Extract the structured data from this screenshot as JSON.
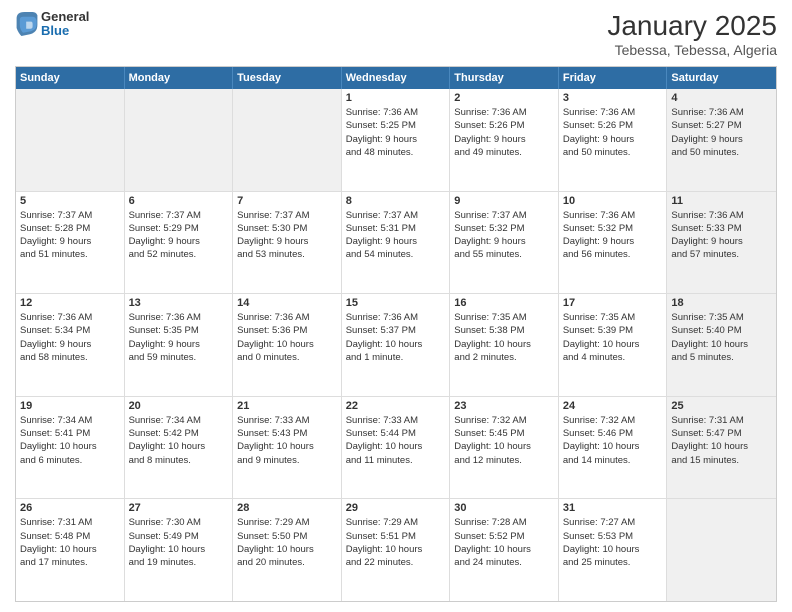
{
  "logo": {
    "general": "General",
    "blue": "Blue"
  },
  "title": "January 2025",
  "subtitle": "Tebessa, Tebessa, Algeria",
  "header_days": [
    "Sunday",
    "Monday",
    "Tuesday",
    "Wednesday",
    "Thursday",
    "Friday",
    "Saturday"
  ],
  "weeks": [
    [
      {
        "day": "",
        "text": "",
        "shaded": true
      },
      {
        "day": "",
        "text": "",
        "shaded": true
      },
      {
        "day": "",
        "text": "",
        "shaded": true
      },
      {
        "day": "1",
        "text": "Sunrise: 7:36 AM\nSunset: 5:25 PM\nDaylight: 9 hours\nand 48 minutes."
      },
      {
        "day": "2",
        "text": "Sunrise: 7:36 AM\nSunset: 5:26 PM\nDaylight: 9 hours\nand 49 minutes."
      },
      {
        "day": "3",
        "text": "Sunrise: 7:36 AM\nSunset: 5:26 PM\nDaylight: 9 hours\nand 50 minutes."
      },
      {
        "day": "4",
        "text": "Sunrise: 7:36 AM\nSunset: 5:27 PM\nDaylight: 9 hours\nand 50 minutes.",
        "shaded": true
      }
    ],
    [
      {
        "day": "5",
        "text": "Sunrise: 7:37 AM\nSunset: 5:28 PM\nDaylight: 9 hours\nand 51 minutes."
      },
      {
        "day": "6",
        "text": "Sunrise: 7:37 AM\nSunset: 5:29 PM\nDaylight: 9 hours\nand 52 minutes."
      },
      {
        "day": "7",
        "text": "Sunrise: 7:37 AM\nSunset: 5:30 PM\nDaylight: 9 hours\nand 53 minutes."
      },
      {
        "day": "8",
        "text": "Sunrise: 7:37 AM\nSunset: 5:31 PM\nDaylight: 9 hours\nand 54 minutes."
      },
      {
        "day": "9",
        "text": "Sunrise: 7:37 AM\nSunset: 5:32 PM\nDaylight: 9 hours\nand 55 minutes."
      },
      {
        "day": "10",
        "text": "Sunrise: 7:36 AM\nSunset: 5:32 PM\nDaylight: 9 hours\nand 56 minutes."
      },
      {
        "day": "11",
        "text": "Sunrise: 7:36 AM\nSunset: 5:33 PM\nDaylight: 9 hours\nand 57 minutes.",
        "shaded": true
      }
    ],
    [
      {
        "day": "12",
        "text": "Sunrise: 7:36 AM\nSunset: 5:34 PM\nDaylight: 9 hours\nand 58 minutes."
      },
      {
        "day": "13",
        "text": "Sunrise: 7:36 AM\nSunset: 5:35 PM\nDaylight: 9 hours\nand 59 minutes."
      },
      {
        "day": "14",
        "text": "Sunrise: 7:36 AM\nSunset: 5:36 PM\nDaylight: 10 hours\nand 0 minutes."
      },
      {
        "day": "15",
        "text": "Sunrise: 7:36 AM\nSunset: 5:37 PM\nDaylight: 10 hours\nand 1 minute."
      },
      {
        "day": "16",
        "text": "Sunrise: 7:35 AM\nSunset: 5:38 PM\nDaylight: 10 hours\nand 2 minutes."
      },
      {
        "day": "17",
        "text": "Sunrise: 7:35 AM\nSunset: 5:39 PM\nDaylight: 10 hours\nand 4 minutes."
      },
      {
        "day": "18",
        "text": "Sunrise: 7:35 AM\nSunset: 5:40 PM\nDaylight: 10 hours\nand 5 minutes.",
        "shaded": true
      }
    ],
    [
      {
        "day": "19",
        "text": "Sunrise: 7:34 AM\nSunset: 5:41 PM\nDaylight: 10 hours\nand 6 minutes."
      },
      {
        "day": "20",
        "text": "Sunrise: 7:34 AM\nSunset: 5:42 PM\nDaylight: 10 hours\nand 8 minutes."
      },
      {
        "day": "21",
        "text": "Sunrise: 7:33 AM\nSunset: 5:43 PM\nDaylight: 10 hours\nand 9 minutes."
      },
      {
        "day": "22",
        "text": "Sunrise: 7:33 AM\nSunset: 5:44 PM\nDaylight: 10 hours\nand 11 minutes."
      },
      {
        "day": "23",
        "text": "Sunrise: 7:32 AM\nSunset: 5:45 PM\nDaylight: 10 hours\nand 12 minutes."
      },
      {
        "day": "24",
        "text": "Sunrise: 7:32 AM\nSunset: 5:46 PM\nDaylight: 10 hours\nand 14 minutes."
      },
      {
        "day": "25",
        "text": "Sunrise: 7:31 AM\nSunset: 5:47 PM\nDaylight: 10 hours\nand 15 minutes.",
        "shaded": true
      }
    ],
    [
      {
        "day": "26",
        "text": "Sunrise: 7:31 AM\nSunset: 5:48 PM\nDaylight: 10 hours\nand 17 minutes."
      },
      {
        "day": "27",
        "text": "Sunrise: 7:30 AM\nSunset: 5:49 PM\nDaylight: 10 hours\nand 19 minutes."
      },
      {
        "day": "28",
        "text": "Sunrise: 7:29 AM\nSunset: 5:50 PM\nDaylight: 10 hours\nand 20 minutes."
      },
      {
        "day": "29",
        "text": "Sunrise: 7:29 AM\nSunset: 5:51 PM\nDaylight: 10 hours\nand 22 minutes."
      },
      {
        "day": "30",
        "text": "Sunrise: 7:28 AM\nSunset: 5:52 PM\nDaylight: 10 hours\nand 24 minutes."
      },
      {
        "day": "31",
        "text": "Sunrise: 7:27 AM\nSunset: 5:53 PM\nDaylight: 10 hours\nand 25 minutes."
      },
      {
        "day": "",
        "text": "",
        "shaded": true
      }
    ]
  ]
}
